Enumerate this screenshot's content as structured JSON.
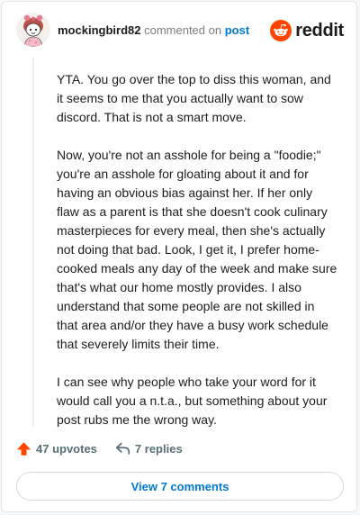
{
  "header": {
    "username": "mockingbird82",
    "commented_text": "commented on",
    "post_link": "post",
    "brand_name": "reddit"
  },
  "comment": {
    "paragraphs": [
      "YTA. You go over the top to diss this woman, and it seems to me that you actually want to sow discord. That is not a smart move.",
      "Now, you're not an asshole for being a \"foodie;\" you're an asshole for gloating about it and for having an obvious bias against her. If her only flaw as a parent is that she doesn't cook culinary masterpieces for every meal, then she's actually not doing that bad. Look, I get it, I prefer home-cooked meals any day of the week and make sure that's what our home mostly provides. I also understand that some people are not skilled in that area and/or they have a busy work schedule that severely limits their time.",
      "I can see why people who take your word for it would call you a n.t.a., but something about your post rubs me the wrong way."
    ]
  },
  "actions": {
    "upvotes": "47 upvotes",
    "replies": "7 replies"
  },
  "view_button": "View 7 comments",
  "colors": {
    "brand": "#ff4500",
    "link": "#0079d3",
    "upvote": "#ff4500"
  },
  "icons": {
    "avatar": "avatar-image",
    "brand": "reddit-snoo-icon",
    "upvote": "upvote-arrow-icon",
    "reply": "reply-arrow-icon"
  }
}
